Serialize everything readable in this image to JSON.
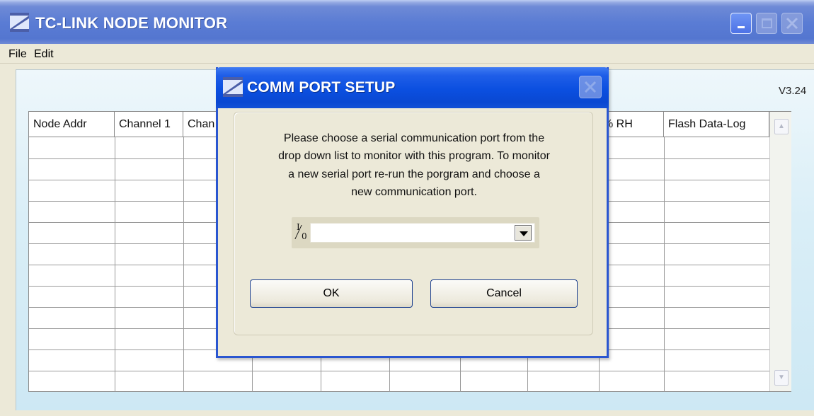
{
  "main_window": {
    "title": "TC-LINK NODE MONITOR",
    "menu": [
      "File",
      "Edit"
    ],
    "version": "V3.24"
  },
  "grid": {
    "columns": [
      "Node Addr",
      "Channel 1",
      "Chan",
      "",
      "",
      "",
      "",
      "% RH",
      "Flash Data-Log"
    ]
  },
  "dialog": {
    "title": "COMM PORT SETUP",
    "message_lines": [
      "Please choose a serial communication port from the",
      "drop down list to monitor with this program. To monitor",
      "a new serial port re-run the porgram and choose a",
      "new communication port."
    ],
    "port_select": {
      "value": "",
      "icon": "io-port-icon"
    },
    "ok_label": "OK",
    "cancel_label": "Cancel"
  }
}
